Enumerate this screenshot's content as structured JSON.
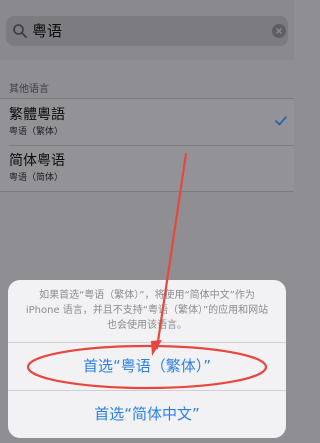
{
  "search": {
    "query": "粤语"
  },
  "section": {
    "header": "其他语言"
  },
  "languages": [
    {
      "title": "繁體粵語",
      "subtitle": "粤语（繁体）",
      "checked": true
    },
    {
      "title": "简体粤语",
      "subtitle": "粤语（简体）",
      "checked": false
    }
  ],
  "sheet": {
    "message_lines": [
      "如果首选“粤语（繁体）”，将使用“简体中文”作为",
      "iPhone 语言，并且不支持“粤语（繁体）”的应用和网站",
      "也会使用该语言。"
    ],
    "primary_button": "首选“粤语（繁体）”",
    "secondary_button": "首选“简体中文”"
  },
  "colors": {
    "accent": "#2b80e6",
    "annotation": "#e8473f"
  }
}
